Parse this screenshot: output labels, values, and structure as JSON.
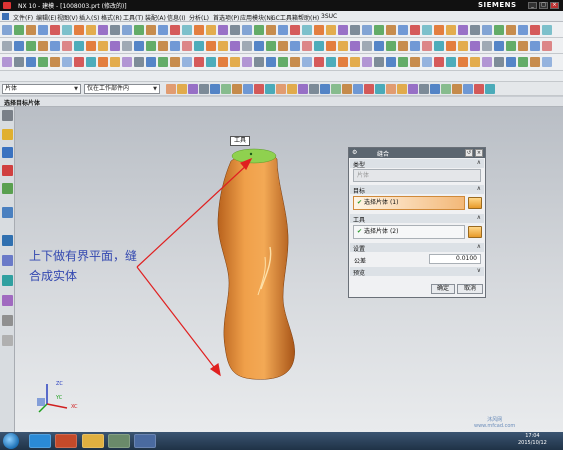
{
  "window": {
    "title": "NX 10 - 建模 - [1008003.prt (修改的)]",
    "brand": "SIEMENS",
    "controls": [
      "_",
      "□",
      "×"
    ]
  },
  "menubar": {
    "items": [
      "文件(F)",
      "编辑(E)",
      "视图(V)",
      "插入(S)",
      "格式(R)",
      "工具(T)",
      "装配(A)",
      "信息(I)",
      "分析(L)",
      "首选项(P)",
      "应用模块(N)",
      "GC工具箱",
      "帮助(H)",
      "3SUC"
    ]
  },
  "filters": {
    "type_filter": "片体",
    "scope_filter": "仅在工作部件内"
  },
  "selection_prompt": "选择目标片体",
  "annotation": {
    "line1": "上下做有界平面，缝",
    "line2": "合成实体"
  },
  "tooltip": "工具",
  "dialog": {
    "title": "缝合",
    "sections": {
      "type": {
        "header": "类型",
        "value": "片体"
      },
      "target": {
        "header": "目标",
        "row_label": "选择片体 (1)"
      },
      "tool": {
        "header": "工具",
        "row_label": "选择片体 (2)"
      },
      "settings": {
        "header": "设置",
        "tolerance_label": "公差",
        "tolerance_value": "0.0100"
      },
      "preview": {
        "header": "预览"
      }
    },
    "ok_label": "确定",
    "cancel_label": "取消"
  },
  "viewport": {
    "triad": {
      "z_label": "ZC",
      "y_label": "YC",
      "x_label": "XC"
    }
  },
  "taskbar": {
    "time": "17:04",
    "date": "2015/10/12"
  },
  "watermark": {
    "line1": "沐风网",
    "line2": "www.mfcad.com"
  },
  "colors": {
    "body_orange": "#e8923a",
    "top_cap_green": "#8fd14f",
    "arrow_red": "#e02020",
    "annotation_blue": "#3348b0",
    "dialog_title": "#5c6670"
  }
}
